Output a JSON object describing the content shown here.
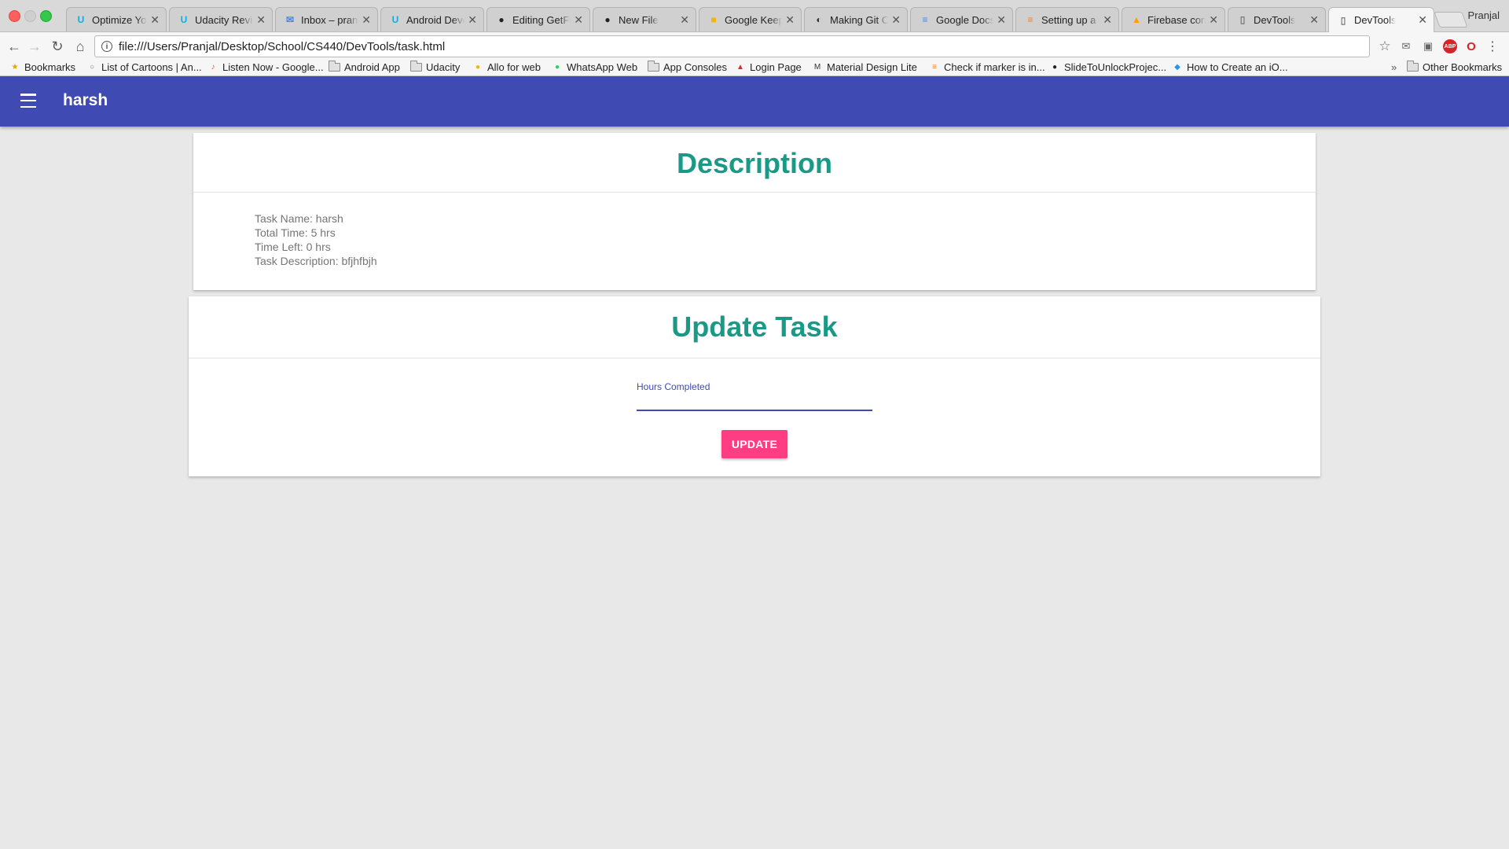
{
  "browser": {
    "tabs": [
      {
        "title": "Optimize Your",
        "favicon": "udacity-icon",
        "color": "#02b3e4"
      },
      {
        "title": "Udacity Review",
        "favicon": "udacity-icon",
        "color": "#02b3e4"
      },
      {
        "title": "Inbox – pranjal",
        "favicon": "inbox-icon",
        "color": "#4285f4"
      },
      {
        "title": "Android Devel",
        "favicon": "udacity-icon",
        "color": "#02b3e4"
      },
      {
        "title": "Editing GetFit",
        "favicon": "github-icon",
        "color": "#222222"
      },
      {
        "title": "New File",
        "favicon": "github-icon",
        "color": "#222222"
      },
      {
        "title": "Google Keep",
        "favicon": "keep-icon",
        "color": "#f6b400"
      },
      {
        "title": "Making Git Co",
        "favicon": "git-icon",
        "color": "#333333"
      },
      {
        "title": "Google Docs",
        "favicon": "docs-icon",
        "color": "#4285f4"
      },
      {
        "title": "Setting up a g",
        "favicon": "stackoverflow-icon",
        "color": "#f48024"
      },
      {
        "title": "Firebase cons",
        "favicon": "firebase-icon",
        "color": "#ffa000"
      },
      {
        "title": "DevTools",
        "favicon": "page-icon",
        "color": "#777777"
      },
      {
        "title": "DevTools",
        "favicon": "page-icon",
        "color": "#777777"
      }
    ],
    "active_tab": 12,
    "profile_name": "Pranjal",
    "url": "file:///Users/Pranjal/Desktop/School/CS440/DevTools/task.html",
    "bookmarks": [
      {
        "label": "Bookmarks",
        "icon": "star-icon"
      },
      {
        "label": "List of Cartoons | An...",
        "icon": "globe-icon"
      },
      {
        "label": "Listen Now - Google...",
        "icon": "music-icon"
      },
      {
        "label": "Android App",
        "icon": "folder-icon"
      },
      {
        "label": "Udacity",
        "icon": "folder-icon"
      },
      {
        "label": "Allo for web",
        "icon": "allo-icon"
      },
      {
        "label": "WhatsApp Web",
        "icon": "whatsapp-icon"
      },
      {
        "label": "App Consoles",
        "icon": "folder-icon"
      },
      {
        "label": "Login Page",
        "icon": "angular-icon"
      },
      {
        "label": "Material Design Lite",
        "icon": "mdl-icon"
      },
      {
        "label": "Check if marker is in...",
        "icon": "stackoverflow-icon"
      },
      {
        "label": "SlideToUnlockProjec...",
        "icon": "github-icon"
      },
      {
        "label": "How to Create an iO...",
        "icon": "swift-icon"
      }
    ],
    "overflow_label": "»",
    "other_bookmarks": "Other Bookmarks"
  },
  "app": {
    "title": "harsh",
    "colors": {
      "primary": "#3f4bb3",
      "accent": "#ff3d83",
      "heading": "#1a9a86"
    }
  },
  "description": {
    "heading": "Description",
    "task_name": "Task Name: harsh",
    "total_time": "Total Time: 5 hrs",
    "time_left": "Time Left: 0 hrs",
    "task_description": "Task Description: bfjhfbjh"
  },
  "update": {
    "heading": "Update Task",
    "hours_label": "Hours Completed",
    "hours_value": "",
    "button_label": "UPDATE"
  }
}
